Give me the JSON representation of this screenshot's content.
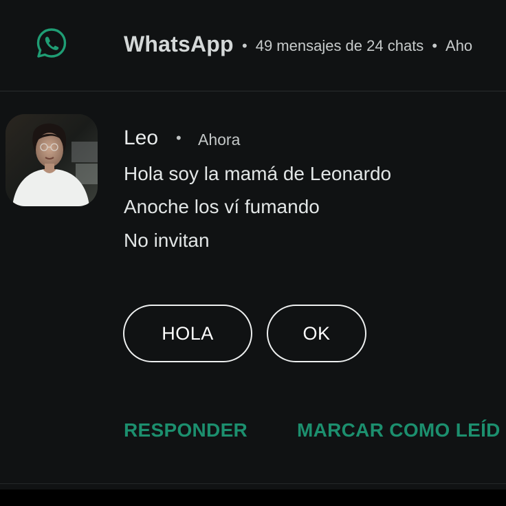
{
  "header": {
    "icon": "whatsapp-icon",
    "app_name": "WhatsApp",
    "separator": "•",
    "summary": "49 mensajes de 24 chats",
    "time_truncated": "Aho"
  },
  "message": {
    "avatar": "contact-photo",
    "sender": "Leo",
    "separator": "•",
    "time": "Ahora",
    "lines": [
      "Hola soy la mamá de Leonardo",
      "Anoche los ví fumando",
      "No invitan"
    ]
  },
  "smart_replies": [
    {
      "label": "HOLA"
    },
    {
      "label": "OK"
    }
  ],
  "actions": {
    "reply_label": "RESPONDER",
    "mark_read_label": "MARCAR COMO LEÍD"
  },
  "colors": {
    "background": "#101213",
    "accent": "#1c8f6e",
    "text": "#e9ecec"
  }
}
